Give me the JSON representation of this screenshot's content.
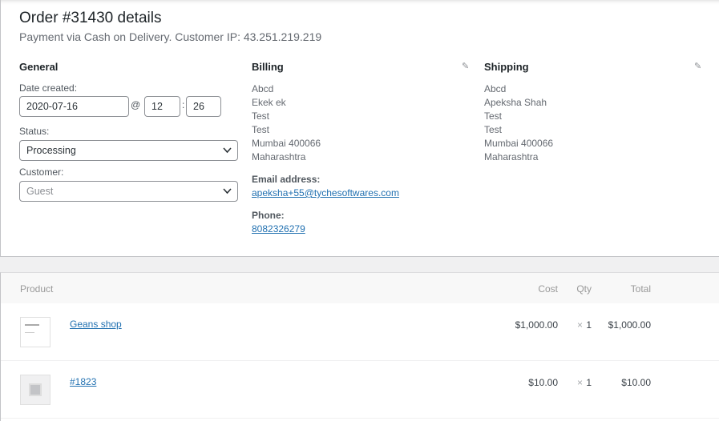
{
  "header": {
    "title": "Order #31430 details",
    "subtitle": "Payment via Cash on Delivery. Customer IP: 43.251.219.219"
  },
  "general": {
    "heading": "General",
    "date_label": "Date created:",
    "date": "2020-07-16",
    "at": "@",
    "hour": "12",
    "colon": ":",
    "minute": "26",
    "status_label": "Status:",
    "status": "Processing",
    "customer_label": "Customer:",
    "customer": "Guest"
  },
  "billing": {
    "heading": "Billing",
    "lines": [
      "Abcd",
      "Ekek ek",
      "Test",
      "Test",
      "Mumbai 400066",
      "Maharashtra"
    ],
    "email_label": "Email address:",
    "email": "apeksha+55@tychesoftwares.com",
    "phone_label": "Phone:",
    "phone": "8082326279"
  },
  "shipping": {
    "heading": "Shipping",
    "lines": [
      "Abcd",
      "Apeksha Shah",
      "Test",
      "Test",
      "Mumbai 400066",
      "Maharashtra"
    ]
  },
  "items": {
    "columns": [
      "Product",
      "Cost",
      "Qty",
      "Total"
    ],
    "rows": [
      {
        "name": "Geans shop",
        "cost": "$1,000.00",
        "qty_x": "×",
        "qty": "1",
        "total": "$1,000.00",
        "thumb": "product-image"
      },
      {
        "name": "#1823",
        "cost": "$10.00",
        "qty_x": "×",
        "qty": "1",
        "total": "$10.00",
        "thumb": "placeholder-image"
      }
    ]
  }
}
